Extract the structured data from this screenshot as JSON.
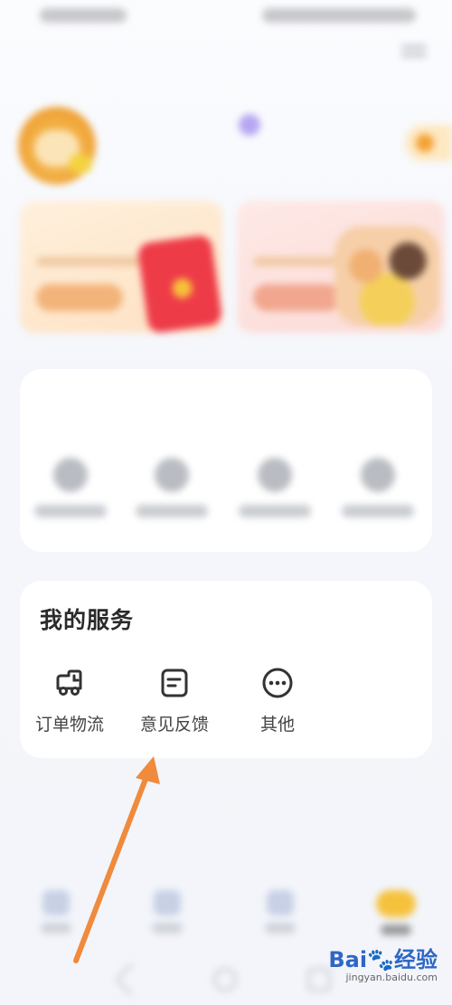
{
  "status_bar": {},
  "profile": {
    "user_name": "",
    "user_sub": ""
  },
  "promos": [
    {
      "title": ""
    },
    {
      "title": ""
    }
  ],
  "study_tools": {
    "title": "",
    "items": [
      {
        "icon": "tool-icon-1"
      },
      {
        "icon": "tool-icon-2"
      },
      {
        "icon": "tool-icon-3"
      },
      {
        "icon": "tool-icon-4"
      }
    ]
  },
  "my_services": {
    "title": "我的服务",
    "items": [
      {
        "label": "订单物流",
        "icon": "truck-icon"
      },
      {
        "label": "意见反馈",
        "icon": "feedback-icon"
      },
      {
        "label": "其他",
        "icon": "more-icon"
      }
    ]
  },
  "annotation": {
    "color": "#f08a3c"
  },
  "colors": {
    "accent": "#f6c23d",
    "annotation_arrow": "#f08a3c"
  },
  "watermark": {
    "brand": "Bai",
    "brand_paw": "🐾",
    "brand_suffix": "经验",
    "url": "jingyan.baidu.com"
  }
}
